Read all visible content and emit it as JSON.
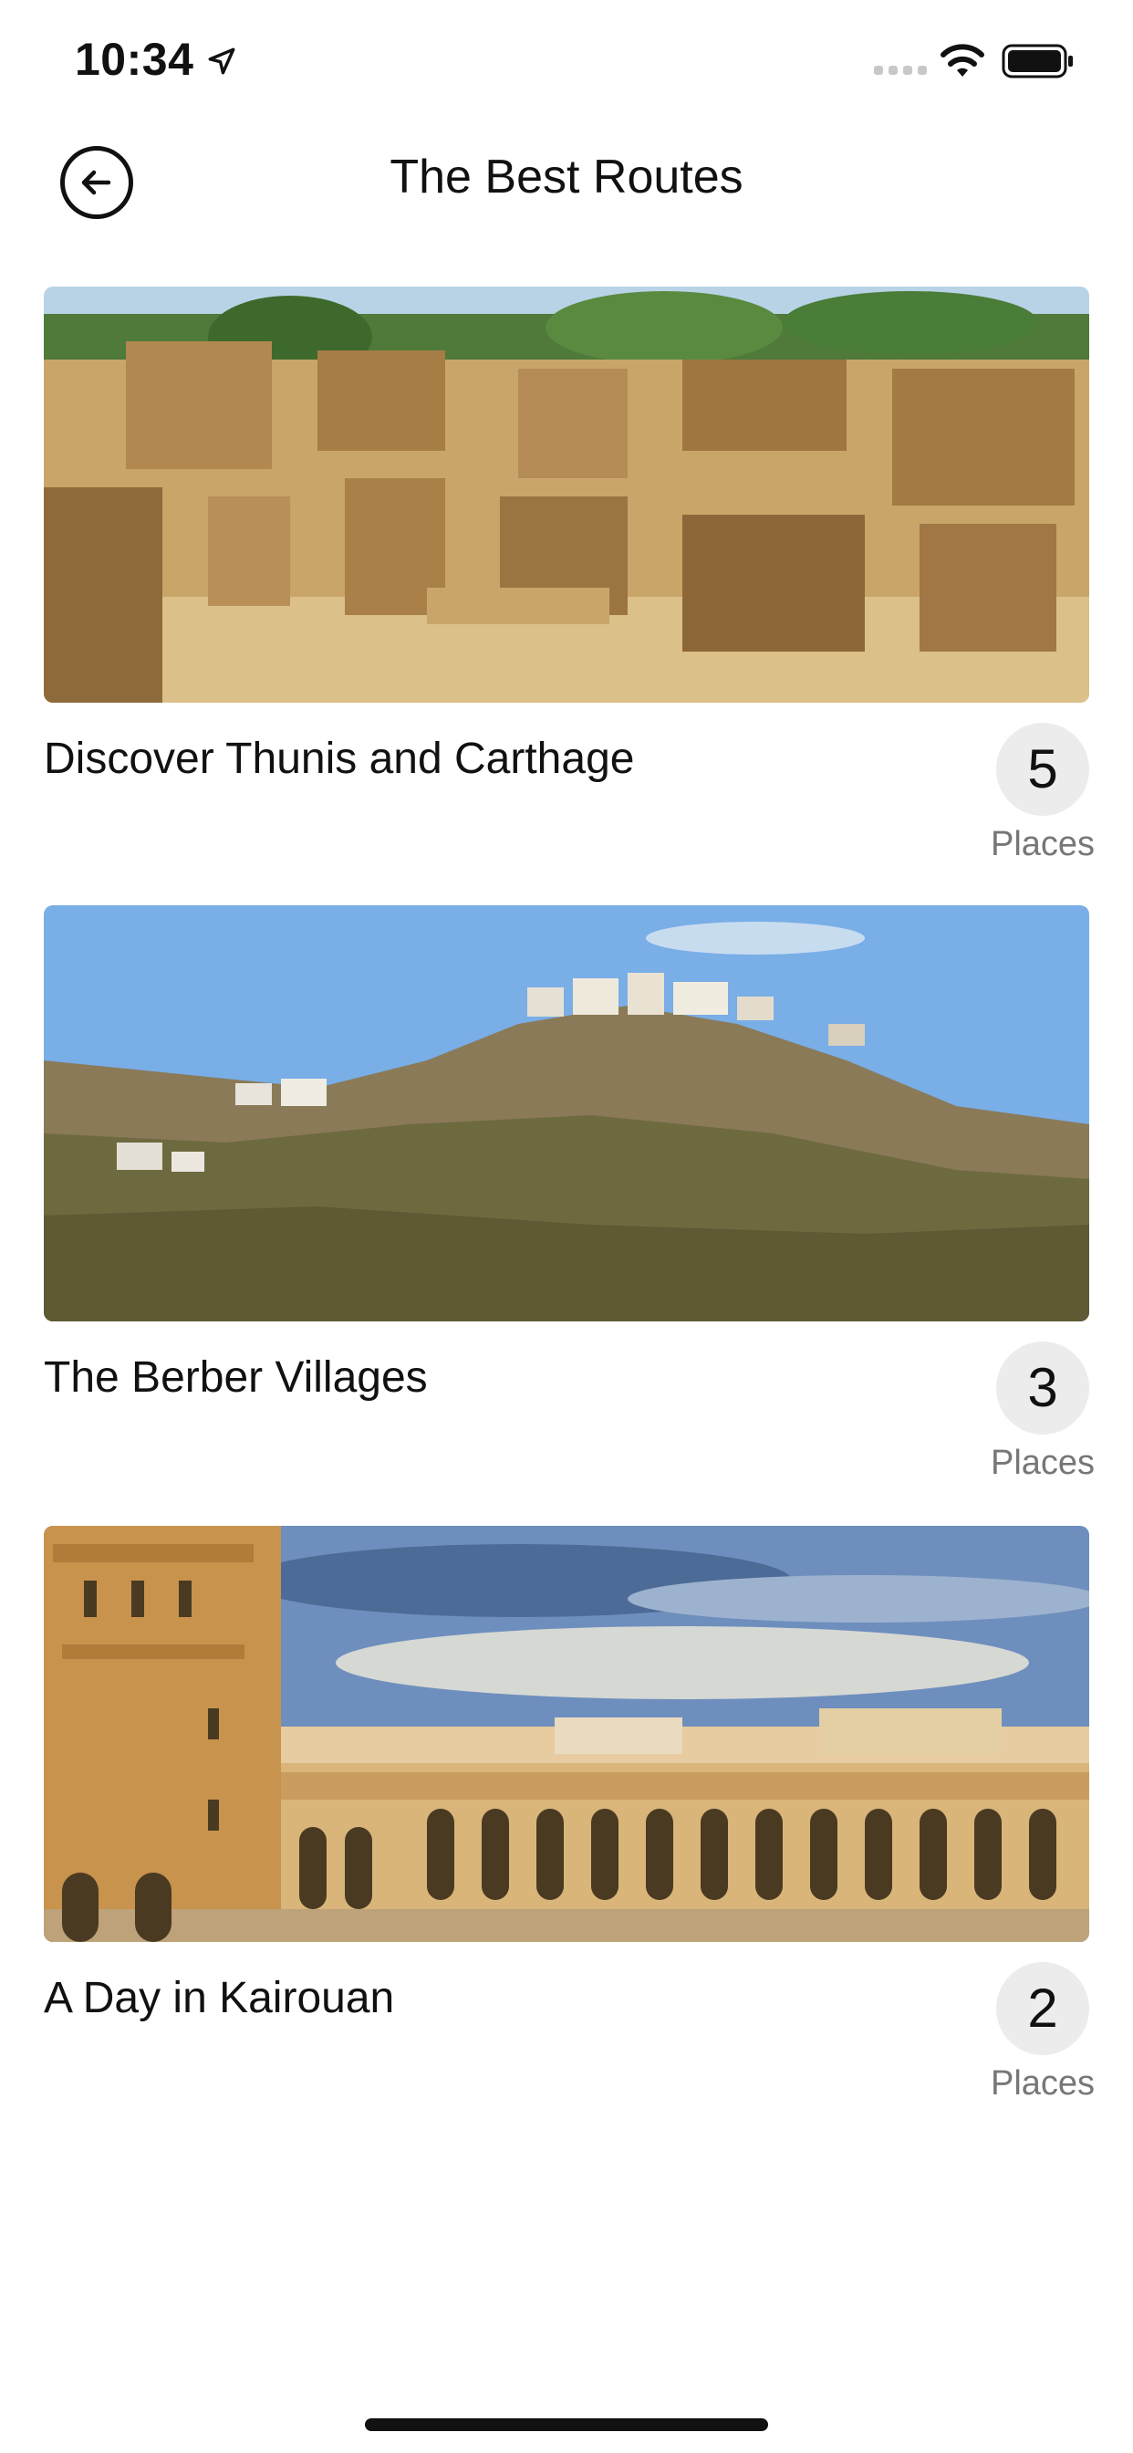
{
  "status_bar": {
    "time": "10:34"
  },
  "header": {
    "title": "The Best Routes"
  },
  "routes": [
    {
      "name": "Discover Thunis and Carthage",
      "count": "5",
      "count_label": "Places",
      "image": "carthage-ruins"
    },
    {
      "name": "The Berber Villages",
      "count": "3",
      "count_label": "Places",
      "image": "berber-hill-village"
    },
    {
      "name": "A Day in Kairouan",
      "count": "2",
      "count_label": "Places",
      "image": "kairouan-mosque"
    }
  ],
  "icons": {
    "back": "arrow-left-circle-icon",
    "location": "location-arrow-icon",
    "wifi": "wifi-icon",
    "battery": "battery-icon",
    "signal": "signal-icon"
  }
}
